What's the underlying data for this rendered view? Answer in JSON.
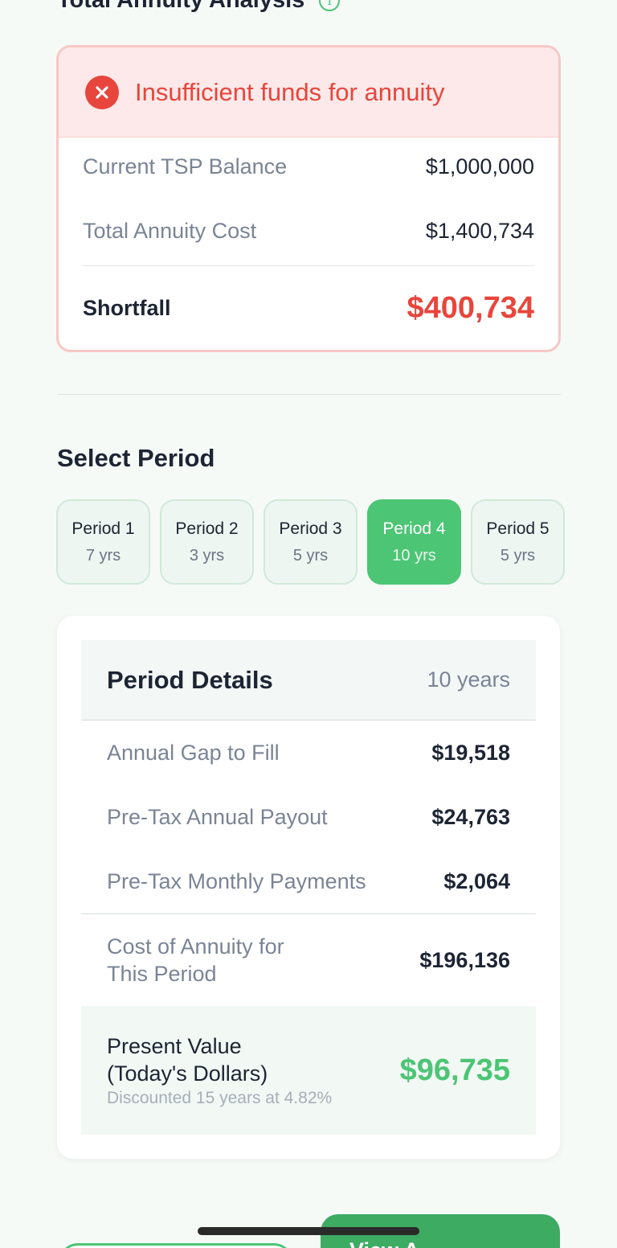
{
  "section": {
    "title": "Total Annuity Analysis",
    "info_icon": "info-icon"
  },
  "alert": {
    "icon": "error-x-icon",
    "title": "Insufficient funds for annuity",
    "rows": [
      {
        "label": "Current TSP Balance",
        "value": "$1,000,000"
      },
      {
        "label": "Total Annuity Cost",
        "value": "$1,400,734"
      }
    ],
    "shortfall_label": "Shortfall",
    "shortfall_value": "$400,734"
  },
  "select_period": {
    "title": "Select Period",
    "options": [
      {
        "name": "Period 1",
        "years": "7 yrs"
      },
      {
        "name": "Period 2",
        "years": "3 yrs"
      },
      {
        "name": "Period 3",
        "years": "5 yrs"
      },
      {
        "name": "Period 4",
        "years": "10 yrs"
      },
      {
        "name": "Period 5",
        "years": "5 yrs"
      }
    ],
    "selected_index": 3
  },
  "details": {
    "title": "Period Details",
    "years": "10 years",
    "rows": [
      {
        "label": "Annual Gap to Fill",
        "value": "$19,518"
      },
      {
        "label": "Pre-Tax Annual Payout",
        "value": "$24,763"
      },
      {
        "label": "Pre-Tax Monthly Payments",
        "value": "$2,064"
      }
    ],
    "cost_label_line1": "Cost of Annuity for",
    "cost_label_line2": "This Period",
    "cost_value": "$196,136",
    "pv_label_line1": "Present Value",
    "pv_label_line2": "(Today's Dollars)",
    "pv_note": "Discounted 15 years at 4.82%",
    "pv_value": "$96,735"
  },
  "footer": {
    "primary_button_label": "View A"
  },
  "colors": {
    "accent_green": "#4cc575",
    "error_red": "#e8453c",
    "error_bg": "#fde9e9"
  }
}
